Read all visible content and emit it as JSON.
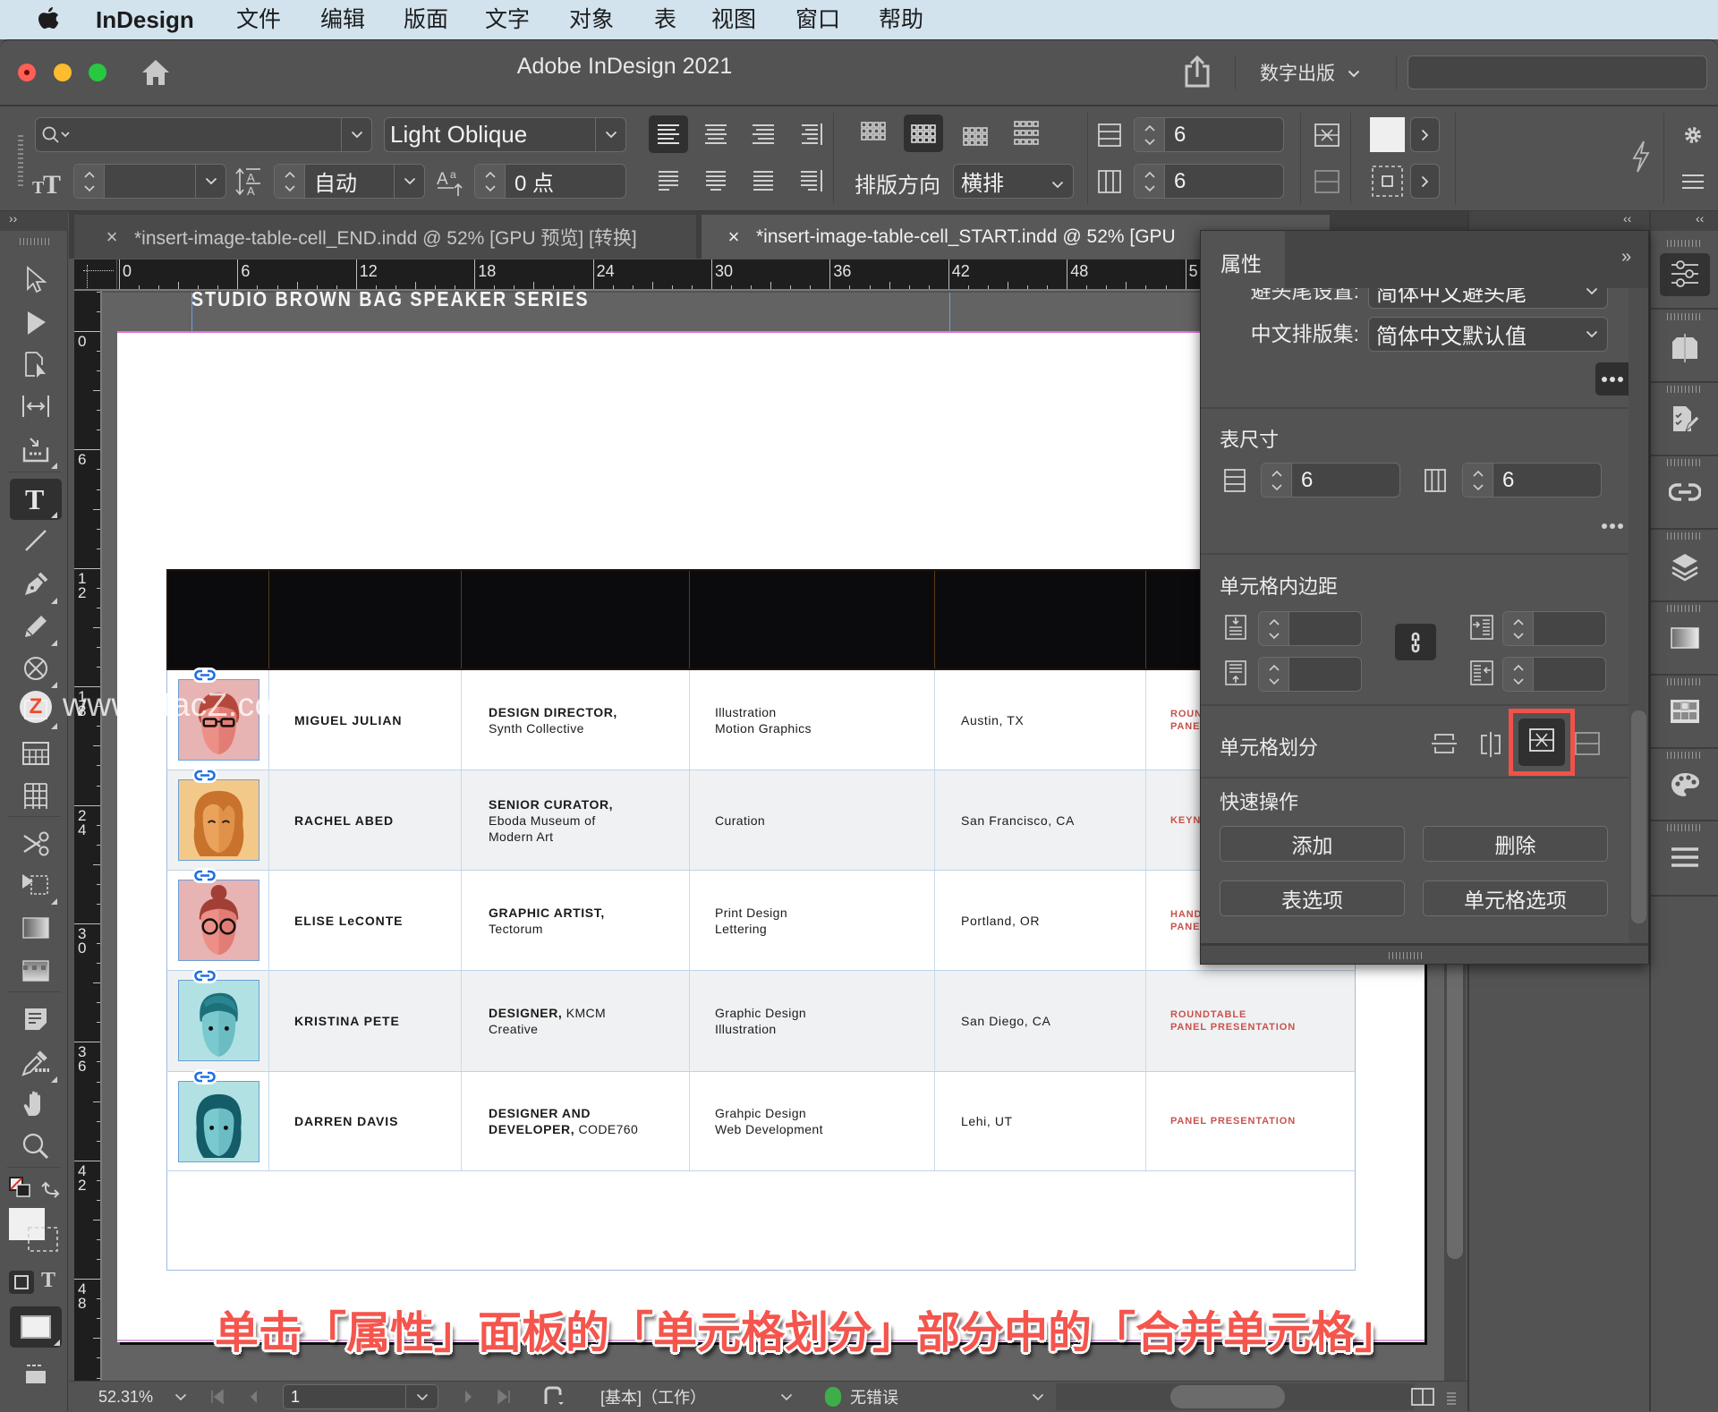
{
  "colors": {
    "caption_red": "#f4554d",
    "highlight_red": "#f0524a",
    "role_red": "#c9524d",
    "status_green": "#3fae49",
    "link_blue": "#1f6fe5",
    "menubar_bg": "#d2e3ed"
  },
  "menubar": {
    "app_name": "InDesign",
    "items": [
      "文件",
      "编辑",
      "版面",
      "文字",
      "对象",
      "表",
      "视图",
      "窗口",
      "帮助"
    ]
  },
  "window": {
    "title": "Adobe InDesign 2021",
    "workspace": "数字出版",
    "search_value": ""
  },
  "control_bar": {
    "font_family": "",
    "font_style": "Light Oblique",
    "font_size": "",
    "leading": "自动",
    "baseline_shift": "0 点",
    "direction_label": "排版方向",
    "direction_value": "横排",
    "table_rows": "6",
    "table_cols": "6"
  },
  "tabs": [
    {
      "label": "*insert-image-table-cell_END.indd @ 52% [GPU 预览] [转换]",
      "close": "×",
      "active": false
    },
    {
      "label": "*insert-image-table-cell_START.indd @ 52% [GPU",
      "close": "×",
      "active": true
    }
  ],
  "rulers": {
    "horizontal": [
      "0",
      "6",
      "12",
      "18",
      "24",
      "30",
      "36",
      "42",
      "48",
      "5"
    ],
    "vertical": [
      "0",
      "6",
      "12",
      "18",
      "24",
      "30",
      "36",
      "42",
      "48"
    ]
  },
  "toolbox": {
    "tools": [
      "selection",
      "direct-selection",
      "page",
      "gap",
      "content-collector",
      "type",
      "line",
      "pen",
      "pencil",
      "rectangle-frame",
      "rectangle",
      "table-grid",
      "table",
      "scissors",
      "free-transform",
      "gradient-swatch",
      "gradient-feather",
      "note",
      "eyedropper",
      "hand",
      "zoom",
      "default-fill-stroke",
      "fill-stroke",
      "formatting-affects",
      "view-mode",
      "screen-mode"
    ],
    "selected": "type"
  },
  "document": {
    "header_text": "STUDIO BROWN BAG SPEAKER SERIES",
    "rows": [
      {
        "name": "MIGUEL JULIAN",
        "title_bold": "DESIGN DIRECTOR,",
        "title_rest": "\nSynth Collective",
        "skills": "Illustration\nMotion Graphics",
        "location": "Austin, TX",
        "event": "ROUN\nPANE"
      },
      {
        "name": "RACHEL ABED",
        "title_bold": "SENIOR CURATOR,",
        "title_rest": "\nEboda Museum of\nModern Art",
        "skills": "Curation",
        "location": "San Francisco, CA",
        "event": "KEYN"
      },
      {
        "name": "ELISE LeCONTE",
        "title_bold": "GRAPHIC ARTIST,",
        "title_rest": "\nTectorum",
        "skills": "Print Design\nLettering",
        "location": "Portland, OR",
        "event": "HAND\nPANE"
      },
      {
        "name": "KRISTINA PETE",
        "title_bold": "DESIGNER,",
        "title_rest": " KMCM\nCreative",
        "skills": "Graphic Design\nIllustration",
        "location": "San Diego, CA",
        "event": "ROUNDTABLE\nPANEL PRESENTATION"
      },
      {
        "name": "DARREN DAVIS",
        "title_bold": "DESIGNER AND\nDEVELOPER,",
        "title_rest": " CODE760",
        "skills": "Grahpic Design\nWeb Development",
        "location": "Lehi, UT",
        "event": "PANEL PRESENTATION"
      }
    ]
  },
  "properties_panel": {
    "tab_label": "属性",
    "kinsoku": {
      "label": "避头尾设置:",
      "value": "简体中文避头尾"
    },
    "mojikumi": {
      "label": "中文排版集:",
      "value": "简体中文默认值"
    },
    "table_size": {
      "label": "表尺寸",
      "rows": "6",
      "cols": "6"
    },
    "cell_inset": {
      "label": "单元格内边距",
      "top": "",
      "bottom": "",
      "left": "",
      "right": ""
    },
    "cell_split": {
      "label": "单元格划分",
      "highlighted": "merge-cells"
    },
    "quick_actions": {
      "label": "快速操作",
      "add": "添加",
      "delete": "删除",
      "table_options": "表选项",
      "cell_options": "单元格选项"
    }
  },
  "status_bar": {
    "zoom": "52.31%",
    "page": "1",
    "preflight_profile": "[基本]（工作）",
    "preflight_status": "无错误"
  },
  "caption": "单击「属性」面板的「单元格划分」部分中的「合并单元格」",
  "watermark": {
    "logo": "Z",
    "text": "www.MacZ.com"
  }
}
